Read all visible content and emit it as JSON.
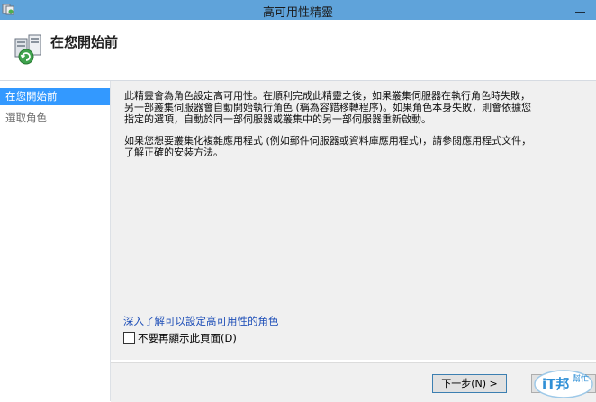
{
  "window": {
    "title": "高可用性精靈",
    "title_bar_color": "#5fa3da",
    "icon": "cluster-app-icon"
  },
  "header": {
    "title": "在您開始前",
    "icon": "failover-cluster-wizard-icon"
  },
  "sidebar": {
    "items": [
      {
        "label": "在您開始前",
        "active": true
      },
      {
        "label": "選取角色",
        "active": false
      }
    ],
    "active_color": "#3399ff"
  },
  "content": {
    "paragraphs": [
      "此精靈會為角色設定高可用性。在順利完成此精靈之後，如果叢集伺服器在執行角色時失敗，\n另一部叢集伺服器會自動開始執行角色 (稱為容錯移轉程序)。如果角色本身失敗，則會依據您\n指定的選項，自動於同一部伺服器或叢集中的另一部伺服器重新啟動。",
      "如果您想要叢集化複雜應用程式 (例如郵件伺服器或資料庫應用程式)，請參閱應用程式文件，\n了解正確的安裝方法。"
    ],
    "learn_more_link": "深入了解可以設定高可用性的角色",
    "dont_show_checkbox_label": "不要再顯示此頁面(D)",
    "dont_show_checked": false,
    "link_color": "#2050b8"
  },
  "footer": {
    "next_label": "下一步(N) >"
  },
  "watermark": {
    "text_main": "iT邦",
    "text_sub": "幫忙"
  }
}
